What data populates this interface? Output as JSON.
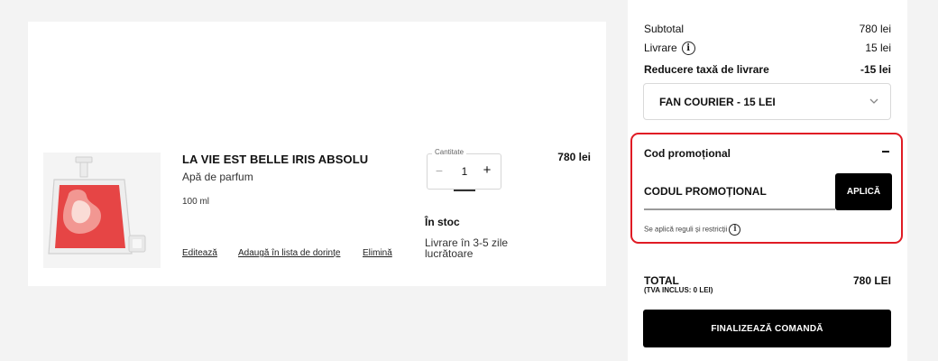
{
  "product": {
    "name": "LA VIE EST BELLE IRIS ABSOLU",
    "type": "Apă de parfum",
    "size": "100 ml",
    "price": "780 lei",
    "stock": "În stoc",
    "delivery": "Livrare în 3-5 zile lucrătoare",
    "actions": {
      "edit": "Editează",
      "wishlist": "Adaugă în lista de dorințe",
      "remove": "Elimină"
    },
    "quantity": {
      "label": "Cantitate",
      "value": "1",
      "minus": "−",
      "plus": "+"
    }
  },
  "summary": {
    "subtotal_label": "Subtotal",
    "subtotal_value": "780 lei",
    "delivery_label": "Livrare",
    "delivery_value": "15 lei",
    "discount_label": "Reducere taxă de livrare",
    "discount_value": "-15 lei",
    "shipping_option": "FAN COURIER - 15 LEI",
    "info_glyph": "i",
    "promo": {
      "title": "Cod promoțional",
      "placeholder": "CODUL PROMOȚIONAL",
      "apply": "APLICĂ",
      "rules": "Se aplică reguli și restricții",
      "highlight_color": "#e01b24"
    },
    "total_label": "TOTAL",
    "total_sub": "(TVA INCLUS: 0 LEI)",
    "total_value": "780 LEI",
    "checkout": "FINALIZEAZĂ COMANDĂ"
  },
  "icons": {
    "info": "info-icon",
    "chevron": "chevron-down-icon",
    "collapse": "minus-icon"
  }
}
